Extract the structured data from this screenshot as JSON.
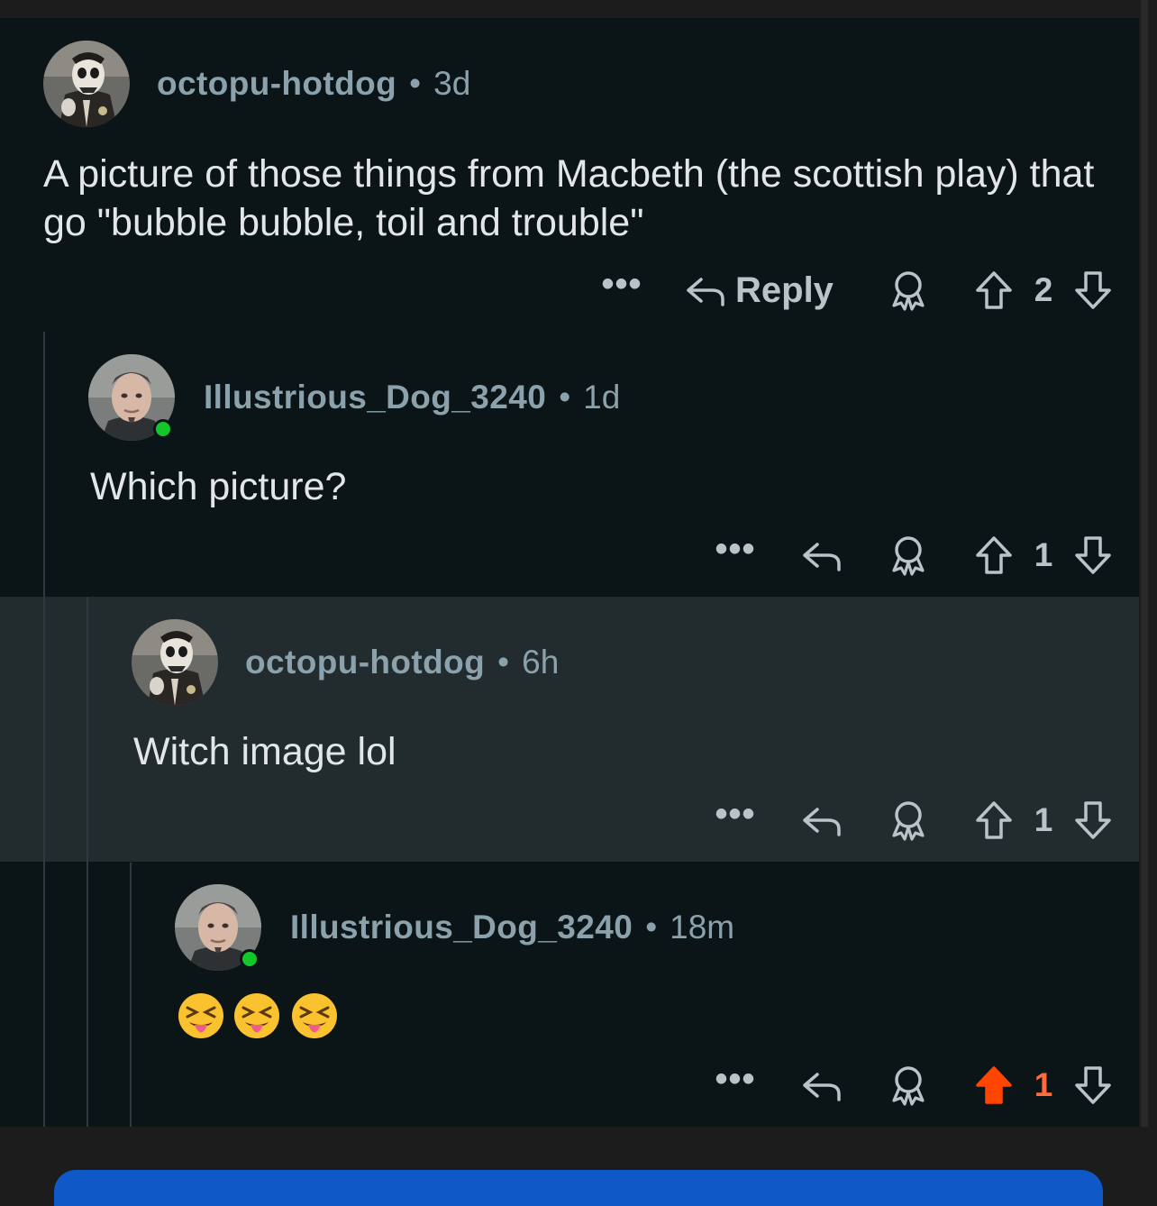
{
  "colors": {
    "background": "#0b1416",
    "highlight": "#222c2e",
    "muted": "#8ba2ad",
    "upvote_active": "#ff4500",
    "online": "#13c72a"
  },
  "comments": [
    {
      "username": "octopu-hotdog",
      "separator": "•",
      "time": "3d",
      "text": "A picture of those things from Macbeth (the scottish play) that go \"bubble bubble, toil and trouble\"",
      "more_label": "•••",
      "reply_label": "Reply",
      "score": "2",
      "icons": [
        "more-icon",
        "reply-icon",
        "award-icon",
        "upvote-icon",
        "downvote-icon"
      ]
    },
    {
      "username": "Illustrious_Dog_3240",
      "separator": "•",
      "time": "1d",
      "text": "Which picture?",
      "more_label": "•••",
      "score": "1",
      "online": true
    },
    {
      "username": "octopu-hotdog",
      "separator": "•",
      "time": "6h",
      "text": "Witch image lol",
      "more_label": "•••",
      "score": "1",
      "highlighted": true
    },
    {
      "username": "Illustrious_Dog_3240",
      "separator": "•",
      "time": "18m",
      "text": "😝😝😝",
      "more_label": "•••",
      "score": "1",
      "upvoted": true,
      "online": true
    }
  ]
}
